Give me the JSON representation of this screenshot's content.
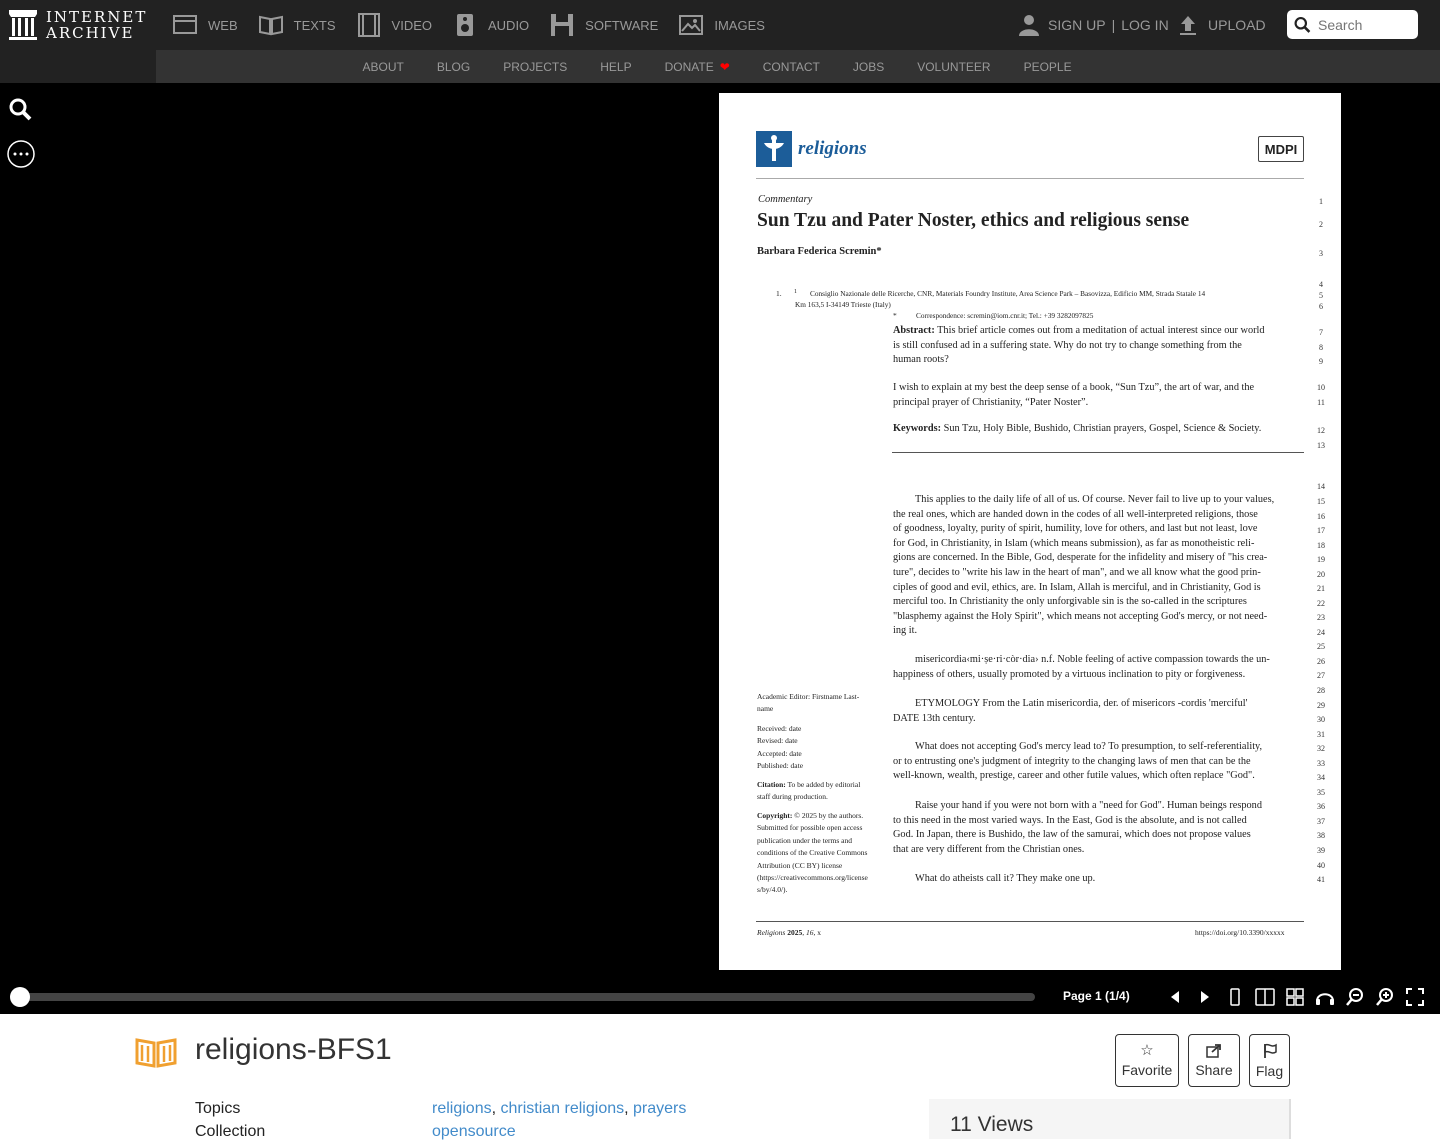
{
  "header": {
    "logo_line1": "INTERNET",
    "logo_line2": "ARCHIVE",
    "mediatypes": [
      {
        "label": "WEB",
        "icon": "web-icon"
      },
      {
        "label": "TEXTS",
        "icon": "texts-icon"
      },
      {
        "label": "VIDEO",
        "icon": "video-icon"
      },
      {
        "label": "AUDIO",
        "icon": "audio-icon"
      },
      {
        "label": "SOFTWARE",
        "icon": "software-icon"
      },
      {
        "label": "IMAGES",
        "icon": "images-icon"
      }
    ],
    "signup": "SIGN UP",
    "separator": "|",
    "login": "LOG IN",
    "upload": "UPLOAD",
    "search_placeholder": "Search"
  },
  "subnav": {
    "items": [
      "ABOUT",
      "BLOG",
      "PROJECTS",
      "HELP",
      "DONATE",
      "CONTACT",
      "JOBS",
      "VOLUNTEER",
      "PEOPLE"
    ],
    "donate_heart_color": "#ff0000"
  },
  "reader": {
    "page_indicator": "Page 1 (1/4)",
    "progress": 0.0,
    "document": {
      "journal": "religions",
      "publisher": "MDPI",
      "type": "Commentary",
      "title": "Sun Tzu and Pater Noster, ethics and religious sense",
      "author": "Barbara Federica Scremin*",
      "affil_num": "1.",
      "affil_sup": "1",
      "affil_line1": "Consiglio Nazionale delle Ricerche, CNR, Materials Foundry Institute, Area Science Park – Basovizza, Edificio MM, Strada Statale 14",
      "affil_line2": "Km 163,5 I-34149 Trieste (Italy)",
      "corr_mark": "*",
      "corr": "Correspondence: scremin@iom.cnr.it; Tel.: +39 3282097825",
      "abstract_label": "Abstract:",
      "abstract_lines": [
        "This brief article comes out from a meditation of actual interest since our world",
        "is still confused ad in a suffering state. Why do not try to change something from the",
        "human roots?"
      ],
      "intro_lines": [
        "I wish to explain at my best the deep sense of a book, “Sun Tzu”, the art of war, and the",
        "principal prayer of Christianity, “Pater Noster”."
      ],
      "keywords_label": "Keywords:",
      "keywords": "Sun Tzu, Holy Bible, Bushido, Christian prayers, Gospel, Science & Society.",
      "para1": [
        "This applies to the daily life of all of us. Of course. Never fail to live up to your values,",
        "the real ones, which are handed down in the codes of all well-interpreted religions, those",
        "of goodness, loyalty, purity of spirit, humility, love for others, and last but not least, love",
        "for God, in Christianity, in Islam (which means submission), as far as monotheistic reli-",
        "gions are concerned. In the Bible, God, desperate for the infidelity and misery of \"his crea-",
        "ture\", decides to \"write his law in the heart of man\", and we all know what the good prin-",
        "ciples of good and evil, ethics, are. In Islam, Allah is merciful, and in Christianity, God is",
        "merciful too. In Christianity the only unforgivable sin is the so-called in the scriptures",
        "\"blasphemy against the Holy Spirit\", which means not accepting God's mercy, or not need-",
        "ing it."
      ],
      "para2": [
        "misericordia‹mi·ṣe·ri·còr·dia› n.f. Noble feeling of active compassion towards the un-",
        "happiness of others, usually promoted by a virtuous inclination to pity or forgiveness."
      ],
      "para3": [
        "ETYMOLOGY From the Latin misericordia, der. of misericors -cordis 'merciful'",
        "DATE 13th century."
      ],
      "para4": [
        "What does not accepting God's mercy lead to? To presumption, to self-referentiality,",
        "or to entrusting one's judgment of integrity to the changing laws of men that can be the",
        "well-known, wealth, prestige, career and other futile values, which often replace \"God\"."
      ],
      "para5": [
        "Raise your hand if you were not born with a \"need for God\". Human beings respond",
        "to this need in the most varied ways. In the East, God is the absolute, and is not called",
        "God. In Japan, there is Bushido, the law of the samurai, which does not propose values",
        "that are very different from the Christian ones."
      ],
      "para6": "What do atheists call it? They make one up.",
      "side_editor": [
        "Academic Editor: Firstname Last-",
        "name"
      ],
      "side_dates": [
        "Received: date",
        "Revised: date",
        "Accepted: date",
        "Published: date"
      ],
      "side_citation_label": "Citation:",
      "side_citation": [
        "To be added by editorial",
        "staff during production."
      ],
      "side_copyright_label": "Copyright:",
      "side_copyright": [
        "© 2025 by the authors.",
        "Submitted for possible open access",
        "publication under the terms and",
        "conditions of the Creative Commons",
        "Attribution (CC BY) license",
        "(https://creativecommons.org/license",
        "s/by/4.0/)."
      ],
      "footer_journal": "Religions",
      "footer_year": "2025",
      "footer_vol": "16",
      "footer_rest": ", x",
      "footer_doi": "https://doi.org/10.3390/xxxxx",
      "line_numbers": [
        "1",
        "2",
        "3",
        "4",
        "5",
        "6",
        "7",
        "8",
        "9",
        "10",
        "11",
        "12",
        "13",
        "14",
        "15",
        "16",
        "17",
        "18",
        "19",
        "20",
        "21",
        "22",
        "23",
        "24",
        "25",
        "26",
        "27",
        "28",
        "29",
        "30",
        "31",
        "32",
        "33",
        "34",
        "35",
        "36",
        "37",
        "38",
        "39",
        "40",
        "41"
      ]
    }
  },
  "item": {
    "title": "religions-BFS1",
    "favorite": "Favorite",
    "share": "Share",
    "flag": "Flag",
    "topics_label": "Topics",
    "collection_label": "Collection",
    "topics": [
      "religions",
      "christian religions",
      "prayers"
    ],
    "topic_sep": ",",
    "collection": "opensource",
    "views": "11 Views",
    "link_color": "#428bca"
  }
}
